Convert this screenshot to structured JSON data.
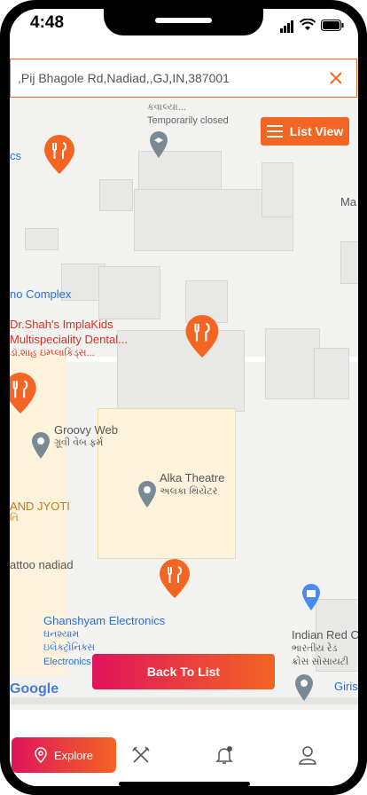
{
  "status_bar": {
    "time": "4:48"
  },
  "search": {
    "value": ",Pij Bhagole Rd,Nadiad,,GJ,IN,387001"
  },
  "map": {
    "list_view_label": "List View",
    "back_to_list_label": "Back To List",
    "places": [
      {
        "text": "કવાલ્યા..."
      },
      {
        "text": "Temporarily closed"
      },
      {
        "text": "cs"
      },
      {
        "text": "Ma"
      },
      {
        "text": "no Complex"
      },
      {
        "text": "Dr.Shah's ImplaKids"
      },
      {
        "text": "Multispeciality Dental..."
      },
      {
        "text": "ડૉ.શાહ ઇમ્પ્લાકિડ્સ..."
      },
      {
        "text": "Groovy Web"
      },
      {
        "text": "ગ્રૂવી વેબ ફર્મ"
      },
      {
        "text": "Alka Theatre"
      },
      {
        "text": "અલકા થિયેટર"
      },
      {
        "text": "AND JYOTI"
      },
      {
        "text": "તિ"
      },
      {
        "text": "attoo nadiad"
      },
      {
        "text": "Ghanshyam Electronics"
      },
      {
        "text": "ઘનશ્યામ"
      },
      {
        "text": "ઇલેક્ટ્રોનિક્સ"
      },
      {
        "text": "Electronics store"
      },
      {
        "text": "Indian Red C"
      },
      {
        "text": "ભારતીય રેડ"
      },
      {
        "text": "ક્રોસ સોસાયટી"
      },
      {
        "text": "Giris"
      },
      {
        "text": "Google"
      }
    ]
  },
  "tabbar": {
    "explore_label": "Explore"
  },
  "colors": {
    "accent": "#f26522",
    "gradient_start": "#e0145c"
  }
}
